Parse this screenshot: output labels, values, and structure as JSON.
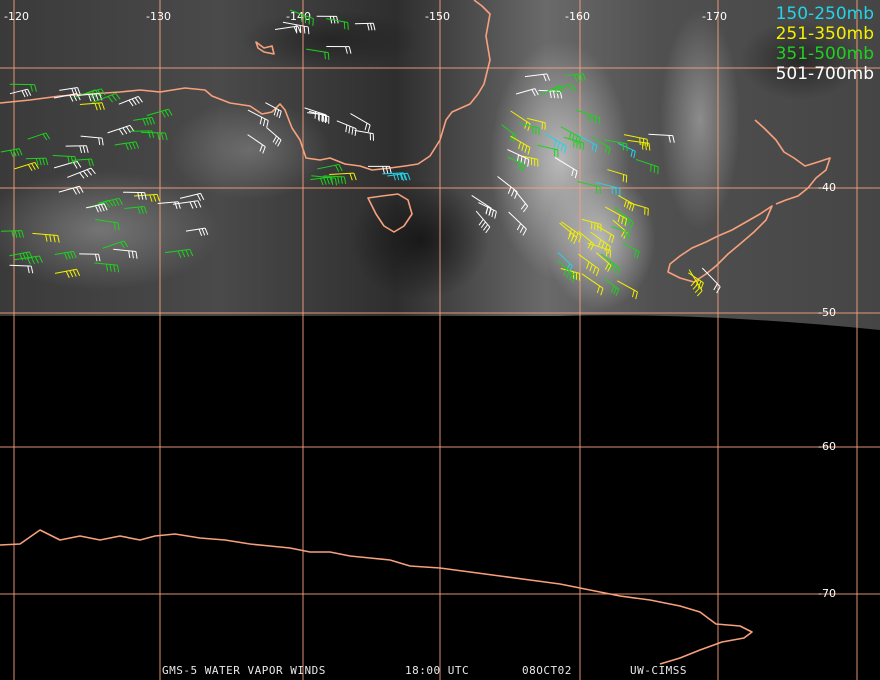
{
  "legend": [
    {
      "label": "150-250mb",
      "color": "#22d4e8"
    },
    {
      "label": "251-350mb",
      "color": "#f2f200"
    },
    {
      "label": "351-500mb",
      "color": "#1ed21e"
    },
    {
      "label": "501-700mb",
      "color": "#ffffff"
    }
  ],
  "longitude_labels": [
    "-120",
    "-130",
    "-140",
    "-150",
    "-160",
    "-170"
  ],
  "latitude_labels": [
    "-40",
    "-50",
    "-60",
    "-70"
  ],
  "footer": {
    "product": "GMS-5 WATER VAPOR WINDS",
    "time": "18:00 UTC",
    "date": "08OCT02",
    "source": "UW-CIMSS"
  },
  "colors": {
    "coastline": "#f7a17c",
    "grid": "#f7a17c",
    "background": "#000000"
  }
}
